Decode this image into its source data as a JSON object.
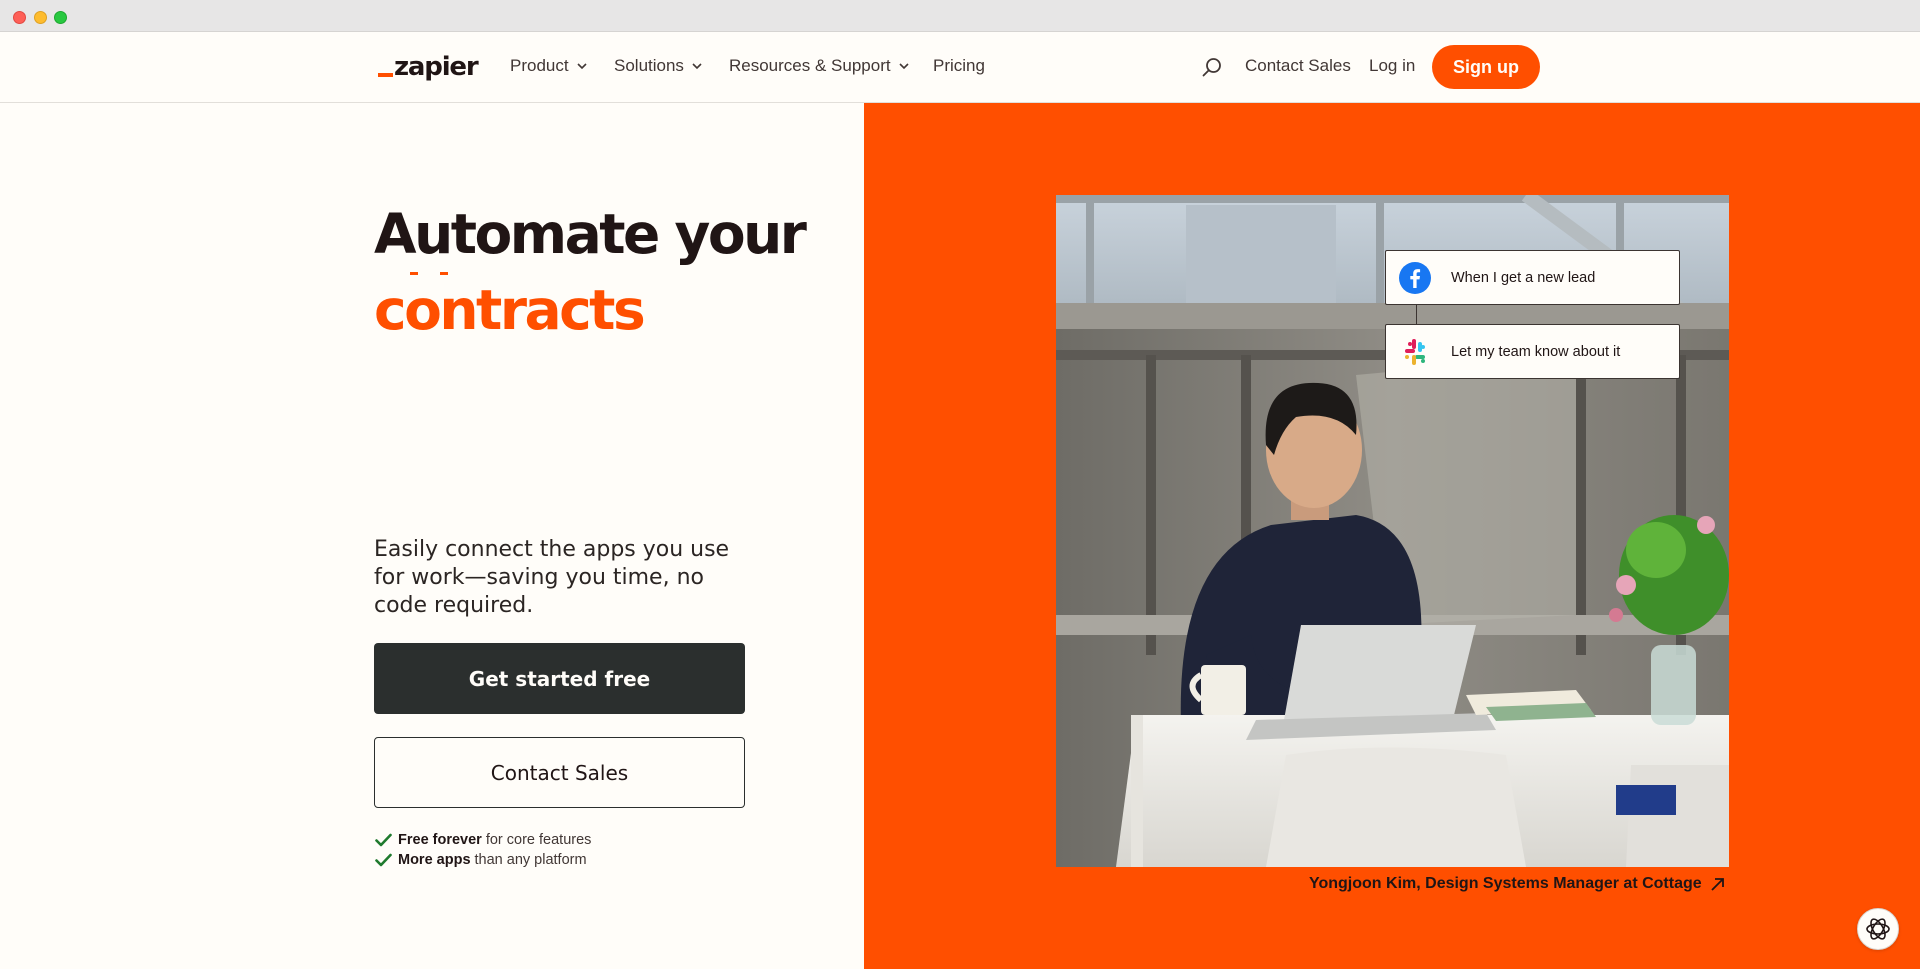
{
  "window": {
    "controls": [
      "close",
      "minimize",
      "maximize"
    ]
  },
  "nav": {
    "logo_text": "zapier",
    "items": [
      {
        "label": "Product",
        "has_dropdown": true
      },
      {
        "label": "Solutions",
        "has_dropdown": true
      },
      {
        "label": "Resources & Support",
        "has_dropdown": true
      },
      {
        "label": "Pricing",
        "has_dropdown": false
      }
    ],
    "search_icon": "search-icon",
    "contact_sales": "Contact Sales",
    "login": "Log in",
    "signup": "Sign up"
  },
  "hero": {
    "headline": "Automate your",
    "headline_rotating_word": "contracts",
    "subtext": "Easily connect the apps you use for work—saving you time, no code required.",
    "cta_primary": "Get started free",
    "cta_secondary": "Contact Sales",
    "perks": [
      {
        "bold": "Free forever",
        "rest": "for core features"
      },
      {
        "bold": "More apps",
        "rest": "than any platform"
      }
    ]
  },
  "zap_example": {
    "trigger": {
      "app_icon": "facebook-icon",
      "label": "When I get a new lead"
    },
    "action": {
      "app_icon": "slack-icon",
      "label": "Let my team know about it"
    }
  },
  "photo_caption": "Yongjoon Kim, Design Systems Manager at Cottage",
  "colors": {
    "brand_orange": "#ff4f00",
    "page_background": "#fffdf9",
    "dark_text": "#201515",
    "primary_button": "#2b2f2e",
    "facebook_blue": "#1877f2"
  }
}
